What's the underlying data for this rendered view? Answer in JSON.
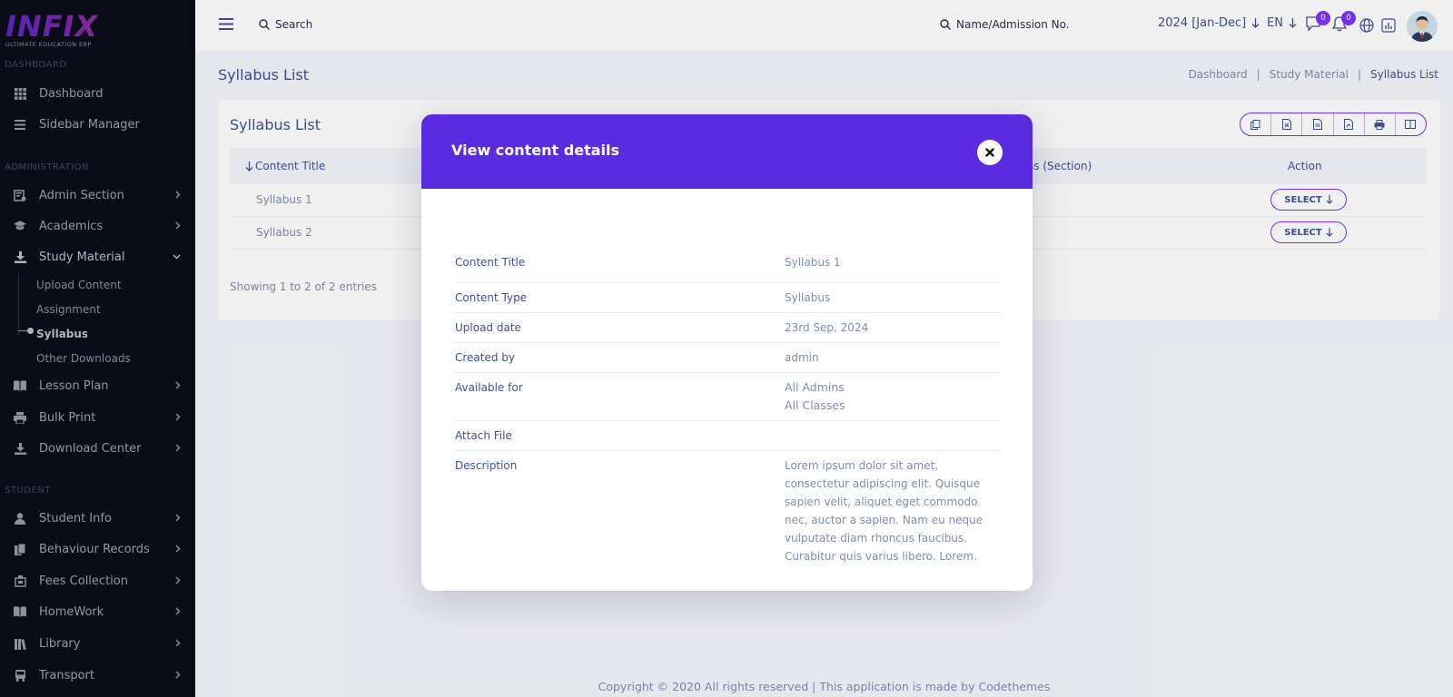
{
  "brand": {
    "logo": "INFIX",
    "tagline": "ULTIMATE EDUCATION ERP"
  },
  "sidebar": {
    "section_dashboard": "DASHBOARD",
    "dashboard": "Dashboard",
    "sidebar_manager": "Sidebar Manager",
    "section_administration": "ADMINISTRATION",
    "admin_section": "Admin Section",
    "academics": "Academics",
    "study_material": "Study Material",
    "study_material_items": [
      "Upload Content",
      "Assignment",
      "Syllabus",
      "Other Downloads"
    ],
    "lesson_plan": "Lesson Plan",
    "bulk_print": "Bulk Print",
    "download_center": "Download Center",
    "section_student": "STUDENT",
    "student_info": "Student Info",
    "behaviour_records": "Behaviour Records",
    "fees_collection": "Fees Collection",
    "homework": "HomeWork",
    "library": "Library",
    "transport": "Transport"
  },
  "header": {
    "search_label": "Search",
    "admission_search": "Name/Admission No.",
    "academic_year": "2024 [Jan-Dec]",
    "language": "EN",
    "message_count": "0",
    "notification_count": "0"
  },
  "page": {
    "title": "Syllabus List",
    "breadcrumb": [
      "Dashboard",
      "Study Material",
      "Syllabus List"
    ]
  },
  "table": {
    "title": "Syllabus List",
    "columns": {
      "content_title": "Content Title",
      "class_section": "ss (Section)",
      "action": "Action"
    },
    "rows": [
      {
        "title": "Syllabus 1",
        "action": "SELECT"
      },
      {
        "title": "Syllabus 2",
        "action": "SELECT"
      }
    ],
    "showing": "Showing 1 to 2 of 2 entries"
  },
  "footer": {
    "text": "Copyright © 2020 All rights reserved | This application is made by Codethemes"
  },
  "modal": {
    "title": "View content details",
    "details": {
      "content_title": {
        "label": "Content Title",
        "value": "Syllabus 1"
      },
      "content_type": {
        "label": "Content Type",
        "value": "Syllabus"
      },
      "upload_date": {
        "label": "Upload date",
        "value": "23rd Sep, 2024"
      },
      "created_by": {
        "label": "Created by",
        "value": "admin"
      },
      "available_for": {
        "label": "Available for",
        "value_1": "All Admins",
        "value_2": "All Classes"
      },
      "attach_file": {
        "label": "Attach File",
        "value": ""
      },
      "description": {
        "label": "Description",
        "value": "Lorem ipsum dolor sit amet, consectetur adipiscing elit. Quisque sapien velit, aliquet eget commodo nec, auctor a sapien. Nam eu neque vulputate diam rhoncus faucibus. Curabitur quis varius libero. Lorem."
      }
    }
  },
  "colors": {
    "accent": "#7c32ff",
    "modal_header": "#5b2be0",
    "text": "#415094",
    "muted": "#828bb2",
    "sidebar": "#0f1424"
  }
}
